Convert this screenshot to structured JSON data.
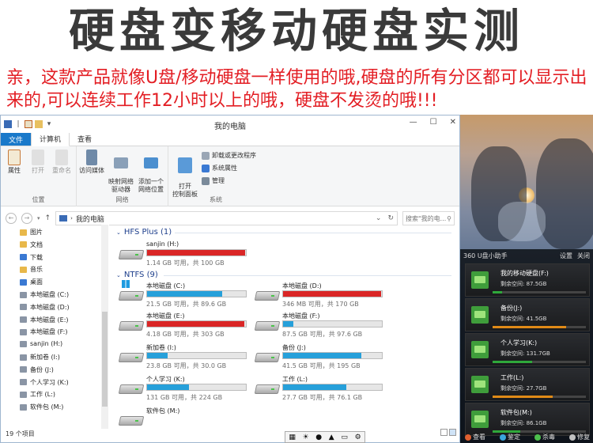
{
  "banner": {
    "title": "硬盘变移动硬盘实测",
    "subtitle": "亲，这款产品就像U盘/移动硬盘一样使用的哦,硬盘的所有分区都可以显示出来的,可以连续工作12小时以上的哦，硬盘不发烫的哦!!!"
  },
  "window": {
    "title": "我的电脑",
    "tabs": [
      "文件",
      "计算机",
      "查看"
    ],
    "ribbon": {
      "location_group": "位置",
      "network_group": "网络",
      "system_group": "系统",
      "properties": "属性",
      "open": "打开",
      "rename": "重命名",
      "access_media": "访问媒体",
      "map_drive": "映射网络\n驱动器",
      "add_location": "添加一个\n网络位置",
      "open_control_panel": "打开\n控制面板",
      "uninstall": "卸载或更改程序",
      "system_props": "系统属性",
      "manage": "管理"
    },
    "address": "我的电脑",
    "search_placeholder": "搜索\"我的电...",
    "status": "19 个项目"
  },
  "nav_items": [
    {
      "label": "图片",
      "color": "#e8b84a"
    },
    {
      "label": "文档",
      "color": "#e8b84a"
    },
    {
      "label": "下载",
      "color": "#3a79d3"
    },
    {
      "label": "音乐",
      "color": "#e8b84a"
    },
    {
      "label": "桌面",
      "color": "#3a79d3"
    },
    {
      "label": "本地磁盘 (C:)",
      "color": "#8a95a5"
    },
    {
      "label": "本地磁盘 (D:)",
      "color": "#8a95a5"
    },
    {
      "label": "本地磁盘 (E:)",
      "color": "#8a95a5"
    },
    {
      "label": "本地磁盘 (F:)",
      "color": "#8a95a5"
    },
    {
      "label": "sanjin (H:)",
      "color": "#8a95a5"
    },
    {
      "label": "新加卷 (I:)",
      "color": "#8a95a5"
    },
    {
      "label": "备份 (J:)",
      "color": "#8a95a5"
    },
    {
      "label": "个人学习 (K:)",
      "color": "#8a95a5"
    },
    {
      "label": "工作 (L:)",
      "color": "#8a95a5"
    },
    {
      "label": "软件包 (M:)",
      "color": "#8a95a5"
    }
  ],
  "groups": {
    "hfs": "HFS Plus (1)",
    "ntfs": "NTFS (9)"
  },
  "drives": [
    {
      "name": "sanjin (H:)",
      "info": "1.14 GB 可用，共 100 GB",
      "used": 0.99,
      "color": "#da2626"
    },
    {
      "name": "本地磁盘 (C:)",
      "info": "21.5 GB 可用，共 89.6 GB",
      "used": 0.76,
      "color": "#26a0da"
    },
    {
      "name": "本地磁盘 (D:)",
      "info": "346 MB 可用，共 170 GB",
      "used": 0.99,
      "color": "#da2626"
    },
    {
      "name": "本地磁盘 (E:)",
      "info": "4.18 GB 可用，共 303 GB",
      "used": 0.98,
      "color": "#da2626"
    },
    {
      "name": "本地磁盘 (F:)",
      "info": "87.5 GB 可用，共 97.6 GB",
      "used": 0.1,
      "color": "#26a0da"
    },
    {
      "name": "新加卷 (I:)",
      "info": "23.8 GB 可用，共 30.0 GB",
      "used": 0.21,
      "color": "#26a0da"
    },
    {
      "name": "备份 (J:)",
      "info": "41.5 GB 可用，共 195 GB",
      "used": 0.79,
      "color": "#26a0da"
    },
    {
      "name": "个人学习 (K:)",
      "info": "131 GB 可用，共 224 GB",
      "used": 0.42,
      "color": "#26a0da"
    },
    {
      "name": "工作 (L:)",
      "info": "27.7 GB 可用，共 76.1 GB",
      "used": 0.64,
      "color": "#26a0da"
    },
    {
      "name": "软件包 (M:)",
      "info": "",
      "used": 0,
      "color": "#26a0da"
    }
  ],
  "widget": {
    "title": "360 U盘小助手",
    "settings": "设置",
    "close": "关闭",
    "items": [
      {
        "name": "我的移动硬盘(F:)",
        "free": "剩余空间: 87.5GB",
        "used": 0.1,
        "color": "#2fa83b"
      },
      {
        "name": "备份(J:)",
        "free": "剩余空间: 41.5GB",
        "used": 0.79,
        "color": "#e08a17"
      },
      {
        "name": "个人学习(K:)",
        "free": "剩余空间: 131.7GB",
        "used": 0.42,
        "color": "#2fa83b"
      },
      {
        "name": "工作(L:)",
        "free": "剩余空间: 27.7GB",
        "used": 0.64,
        "color": "#e08a17"
      },
      {
        "name": "软件包(M:)",
        "free": "剩余空间: 86.1GB",
        "used": 0.3,
        "color": "#2fa83b"
      }
    ],
    "footer": [
      "查看",
      "鉴定",
      "杀毒",
      "修复"
    ]
  },
  "taskbar_icons": [
    "grid-icon",
    "brightness-icon",
    "circle-icon",
    "eject-icon",
    "monitor-icon",
    "gear-icon"
  ],
  "taskbar_glyphs": [
    "▦",
    "☀",
    "●",
    "▲",
    "▭",
    "⚙"
  ]
}
